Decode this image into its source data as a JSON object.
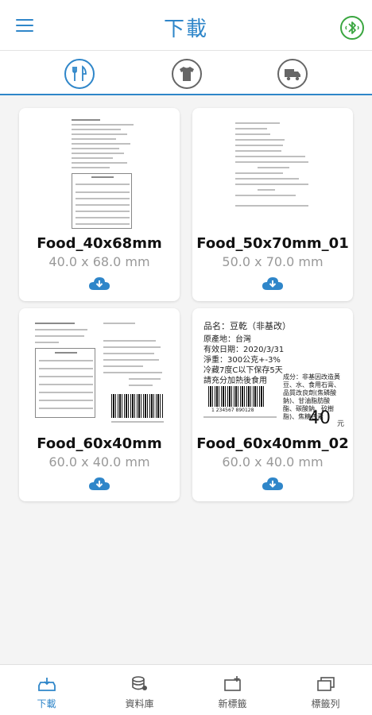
{
  "header": {
    "title": "下載",
    "menu_icon": "menu-icon",
    "bluetooth_icon": "bluetooth-icon",
    "accent_color": "#2f86c9",
    "bluetooth_color": "#3aa640"
  },
  "categories": [
    {
      "icon": "utensils-icon",
      "active": true
    },
    {
      "icon": "shirt-icon",
      "active": false
    },
    {
      "icon": "truck-icon",
      "active": false
    }
  ],
  "templates": [
    {
      "name": "Food_40x68mm",
      "size": "40.0 x 68.0 mm"
    },
    {
      "name": "Food_50x70mm_01",
      "size": "50.0 x 70.0 mm"
    },
    {
      "name": "Food_60x40mm",
      "size": "60.0 x 40.0 mm"
    },
    {
      "name": "Food_60x40mm_02",
      "size": "60.0 x 40.0 mm",
      "preview": {
        "product": "品名：豆乾（非基改）",
        "origin": "原產地：台灣",
        "expiry": "有效日期：2020/3/31",
        "weight": "淨重：300公克+-3%",
        "storage": "冷藏7度C以下保存5天",
        "note": "請充分加熱後食用",
        "ingredients": "成分：非基因改造黃豆、水、食用石膏、品質改良劑(焦磷酸鈉)、甘油脂肪酸酯、碳酸鈉、矽樹脂)、焦糖色素",
        "price": "40",
        "price_unit": "元",
        "barcode_number": "1 234567 890128"
      }
    }
  ],
  "bottom_nav": [
    {
      "label": "下載",
      "icon": "cloud-download-icon",
      "active": true
    },
    {
      "label": "資料庫",
      "icon": "database-icon",
      "active": false
    },
    {
      "label": "新標籤",
      "icon": "new-label-icon",
      "active": false
    },
    {
      "label": "標籤列",
      "icon": "label-list-icon",
      "active": false
    }
  ]
}
